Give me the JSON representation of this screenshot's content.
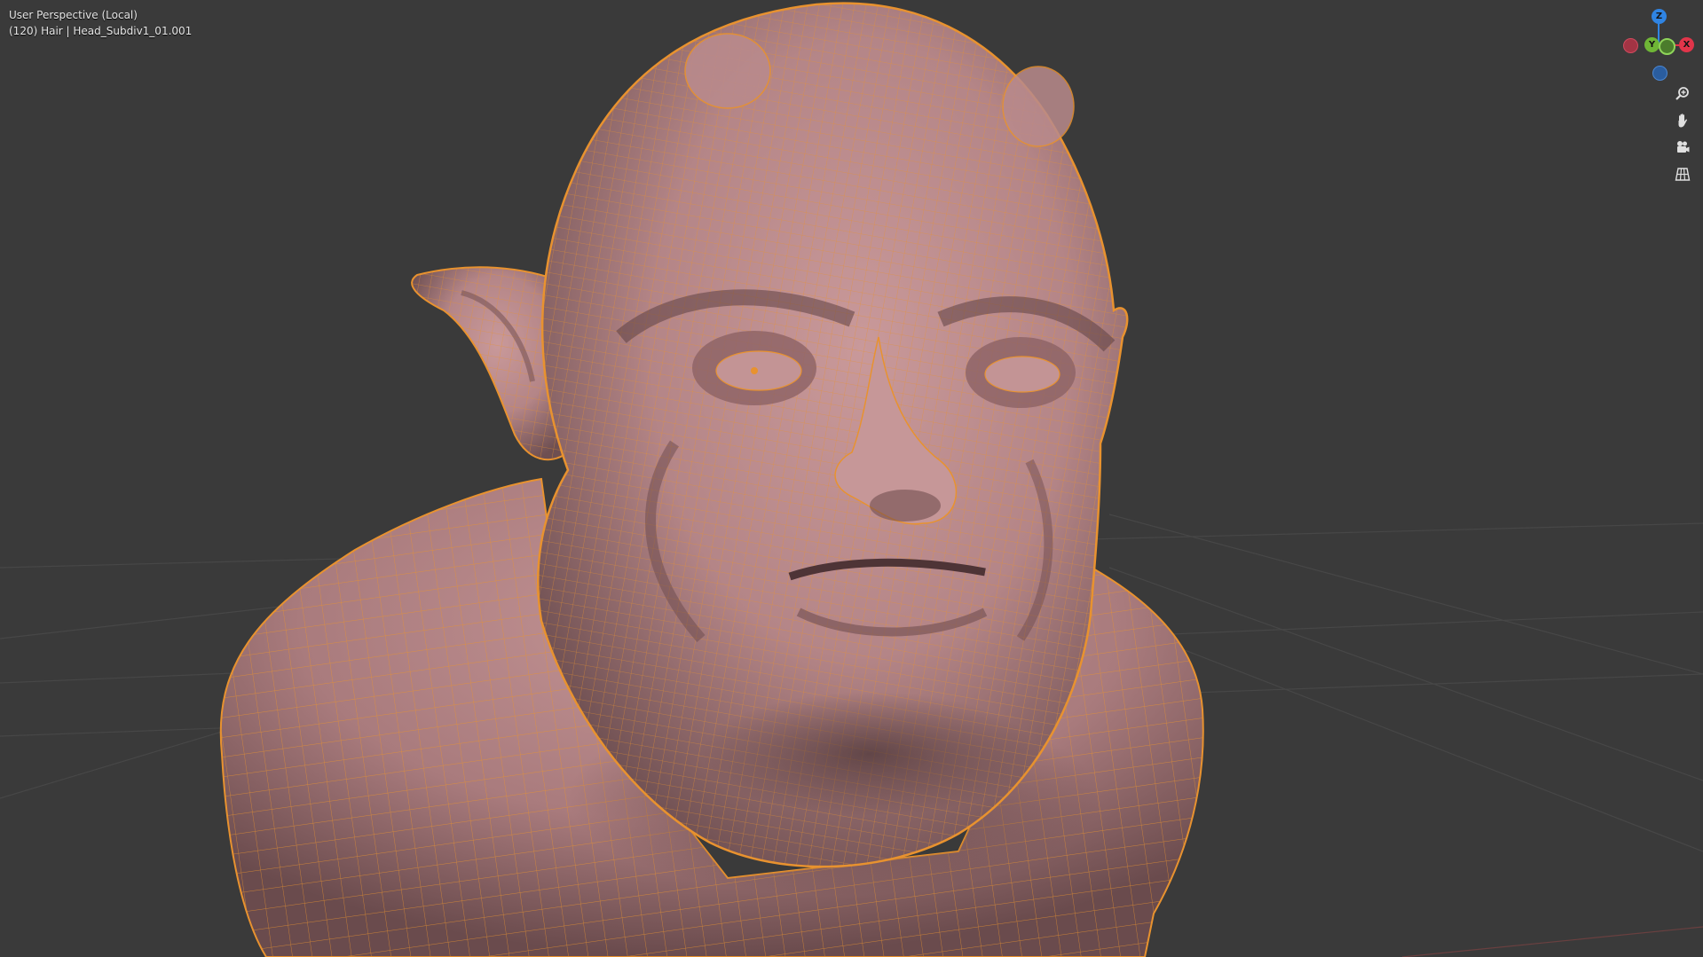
{
  "viewport": {
    "view_name": "User Perspective (Local)",
    "object_info": "(120) Hair | Head_Subdiv1_01.001",
    "background_color": "#3a3a3a",
    "grid_line_color": "#4a4a4a",
    "mesh_color": "#b88688",
    "wire_color": "#e8922f"
  },
  "gizmo": {
    "axes": [
      {
        "name": "Z",
        "color": "#2f84e3"
      },
      {
        "name": "Y",
        "color": "#6fb636"
      },
      {
        "name": "X",
        "color": "#e1354a"
      }
    ],
    "negative_axes": [
      {
        "name": "-X",
        "color": "#a23444"
      },
      {
        "name": "-Y",
        "color": "#4b7c2c"
      },
      {
        "name": "-Z",
        "color": "#2a5d9f"
      }
    ]
  },
  "tools": [
    {
      "name": "zoom",
      "icon": "zoom-icon"
    },
    {
      "name": "pan",
      "icon": "hand-icon"
    },
    {
      "name": "camera",
      "icon": "camera-icon"
    },
    {
      "name": "toggle-perspective",
      "icon": "grid-icon"
    }
  ]
}
